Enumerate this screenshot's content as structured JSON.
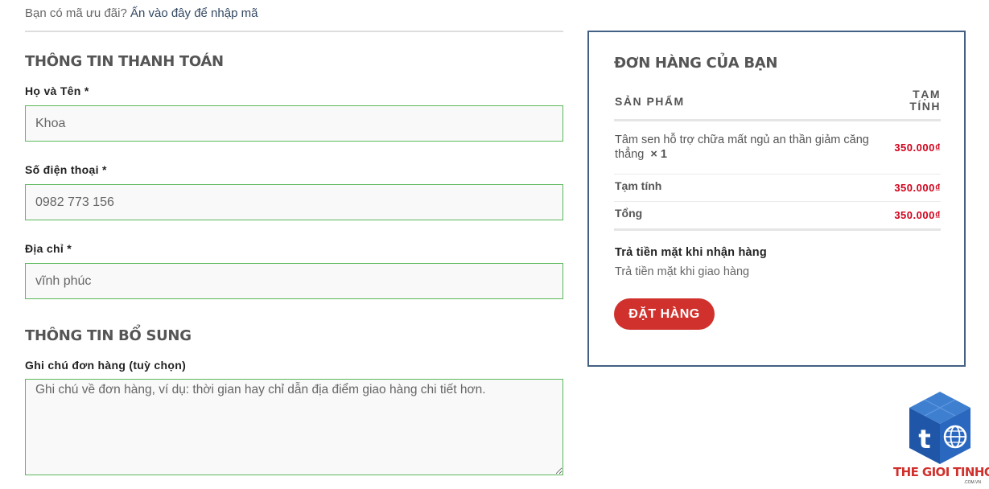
{
  "coupon": {
    "prompt": "Bạn có mã ưu đãi?",
    "link": "Ấn vào đây để nhập mã"
  },
  "billing": {
    "title": "THÔNG TIN THANH TOÁN",
    "name_label": "Họ và Tên",
    "name_value": "Khoa",
    "phone_label": "Số điện thoại",
    "phone_value": "0982 773 156",
    "address_label": "Địa chỉ",
    "address_value": "vĩnh phúc",
    "required_mark": "*"
  },
  "additional": {
    "title": "THÔNG TIN BỔ SUNG",
    "notes_label": "Ghi chú đơn hàng (tuỳ chọn)",
    "notes_placeholder": "Ghi chú về đơn hàng, ví dụ: thời gian hay chỉ dẫn địa điểm giao hàng chi tiết hơn."
  },
  "order": {
    "title": "ĐƠN HÀNG CỦA BẠN",
    "col_product": "SẢN PHẨM",
    "col_subtotal": "TẠM TÍNH",
    "item_name": "Tâm sen hỗ trợ chữa mất ngủ an thần giảm căng thẳng",
    "item_qty": "× 1",
    "item_price": "350.000₫",
    "subtotal_label": "Tạm tính",
    "subtotal_value": "350.000₫",
    "total_label": "Tổng",
    "total_value": "350.000₫",
    "payment_title": "Trả tiền mặt khi nhận hàng",
    "payment_desc": "Trả tiền mặt khi giao hàng",
    "place_order": "ĐẶT HÀNG"
  },
  "watermark": {
    "brand": "THE GIOI TINHOC",
    "domain": ".COM.VN",
    "icon": "cube-t-globe-logo"
  },
  "colors": {
    "accent_red": "#d0312d",
    "price_red": "#d0021b",
    "box_border": "#446084",
    "input_border": "#5cb85c"
  }
}
